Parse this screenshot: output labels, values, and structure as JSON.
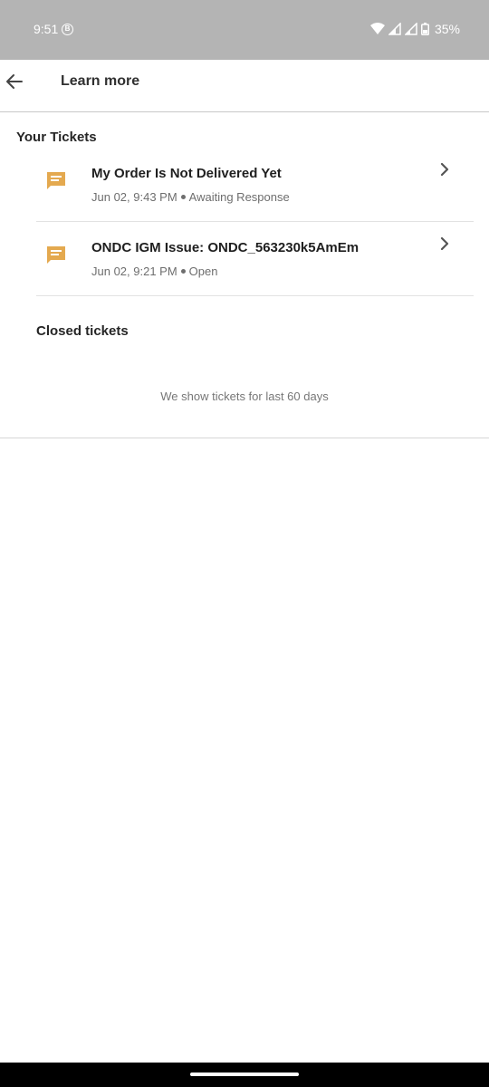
{
  "status_bar": {
    "time": "9:51",
    "battery": "35%",
    "icons": [
      "app-notification-icon",
      "wifi-icon",
      "signal-icon",
      "signal-icon",
      "battery-icon"
    ]
  },
  "app_bar": {
    "title": "Learn more"
  },
  "your_tickets": {
    "title": "Your Tickets",
    "items": [
      {
        "title": "My Order Is Not Delivered Yet",
        "date": "Jun 02, 9:43 PM",
        "status": "Awaiting Response"
      },
      {
        "title": "ONDC IGM Issue: ONDC_563230k5AmEm",
        "date": "Jun 02, 9:21 PM",
        "status": "Open"
      }
    ]
  },
  "closed_tickets": {
    "title": "Closed tickets",
    "note": "We show tickets for last 60 days"
  },
  "colors": {
    "status_bar": "#b4b4b4",
    "ticket_icon": "#e4a94f",
    "text_primary": "#1f1f1f",
    "text_secondary": "#6e6e6e"
  }
}
